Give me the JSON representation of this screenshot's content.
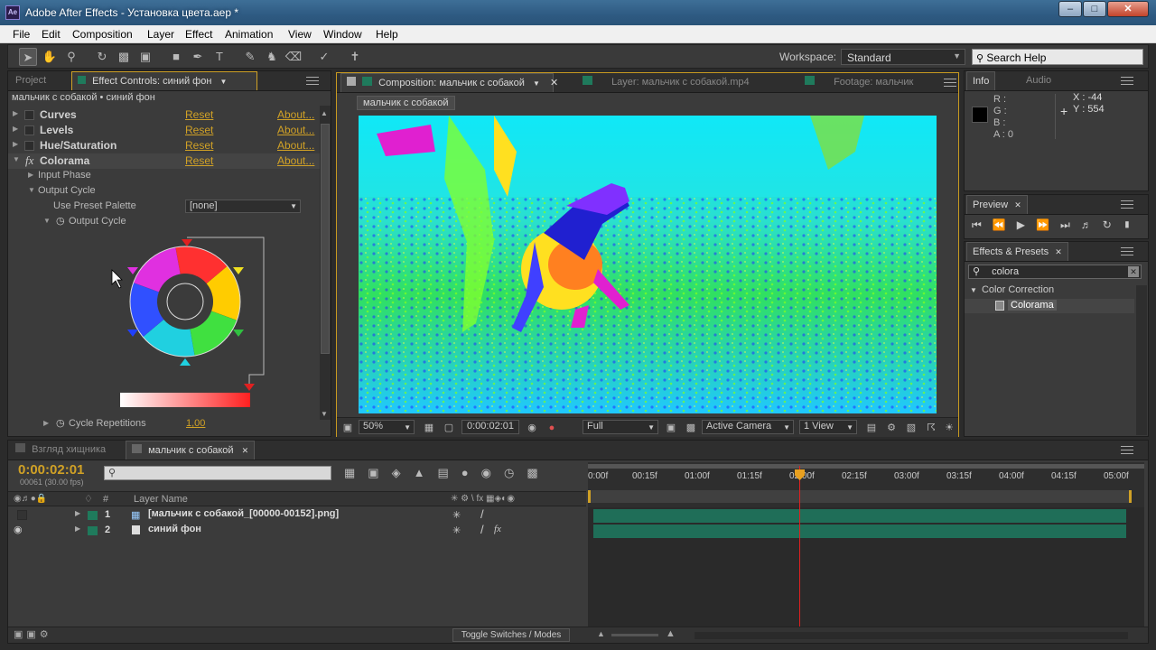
{
  "window": {
    "title": "Adobe After Effects - Установка цвета.aep *",
    "app_icon": "Ae"
  },
  "menu": [
    "File",
    "Edit",
    "Composition",
    "Layer",
    "Effect",
    "Animation",
    "View",
    "Window",
    "Help"
  ],
  "toolbar": {
    "workspace_label": "Workspace:",
    "workspace_value": "Standard",
    "search_placeholder": "Search Help"
  },
  "left_panel": {
    "tabs": [
      "Project",
      "Effect Controls: синий фон"
    ],
    "breadcrumb": "мальчик с собакой • синий фон",
    "effects": [
      {
        "name": "Curves",
        "reset": "Reset",
        "about": "About..."
      },
      {
        "name": "Levels",
        "reset": "Reset",
        "about": "About..."
      },
      {
        "name": "Hue/Saturation",
        "reset": "Reset",
        "about": "About..."
      },
      {
        "name": "Colorama",
        "reset": "Reset",
        "about": "About..."
      }
    ],
    "input_phase": "Input Phase",
    "output_cycle": "Output Cycle",
    "preset_label": "Use Preset Palette",
    "preset_value": "[none]",
    "output_cycle_sub": "Output Cycle",
    "cycle_rep_label": "Cycle Repetitions",
    "cycle_rep_value": "1,00"
  },
  "viewer": {
    "tabs": [
      "Composition: мальчик с собакой",
      "Layer: мальчик с собакой.mp4",
      "Footage: мальчик"
    ],
    "comp_label": "мальчик с собакой",
    "zoom": "50%",
    "timecode": "0:00:02:01",
    "resolution": "Full",
    "camera": "Active Camera",
    "view": "1 View"
  },
  "info": {
    "tabs": [
      "Info",
      "Audio"
    ],
    "r": "R :",
    "g": "G :",
    "b": "B :",
    "a": "A : 0",
    "x": "X : -44",
    "y": "Y : 554"
  },
  "preview": {
    "tab": "Preview"
  },
  "effects_presets": {
    "tab": "Effects & Presets",
    "search": "colora",
    "category": "Color Correction",
    "item": "Colorama"
  },
  "timeline": {
    "tabs": [
      "Взгляд хищника",
      "мальчик с собакой"
    ],
    "timecode": "0:00:02:01",
    "fps": "00061 (30.00 fps)",
    "col_layer": "Layer Name",
    "col_num": "#",
    "ruler": [
      "0:00f",
      "00:15f",
      "01:00f",
      "01:15f",
      "02:00f",
      "02:15f",
      "03:00f",
      "03:15f",
      "04:00f",
      "04:15f",
      "05:00f"
    ],
    "layers": [
      {
        "num": "1",
        "name": "[мальчик с собакой_[00000-00152].png]"
      },
      {
        "num": "2",
        "name": "синий фон"
      }
    ],
    "toggle": "Toggle Switches / Modes"
  },
  "colors": {
    "accent": "#d0a126",
    "track": "#1f6e58",
    "playhead": "#e02020"
  }
}
